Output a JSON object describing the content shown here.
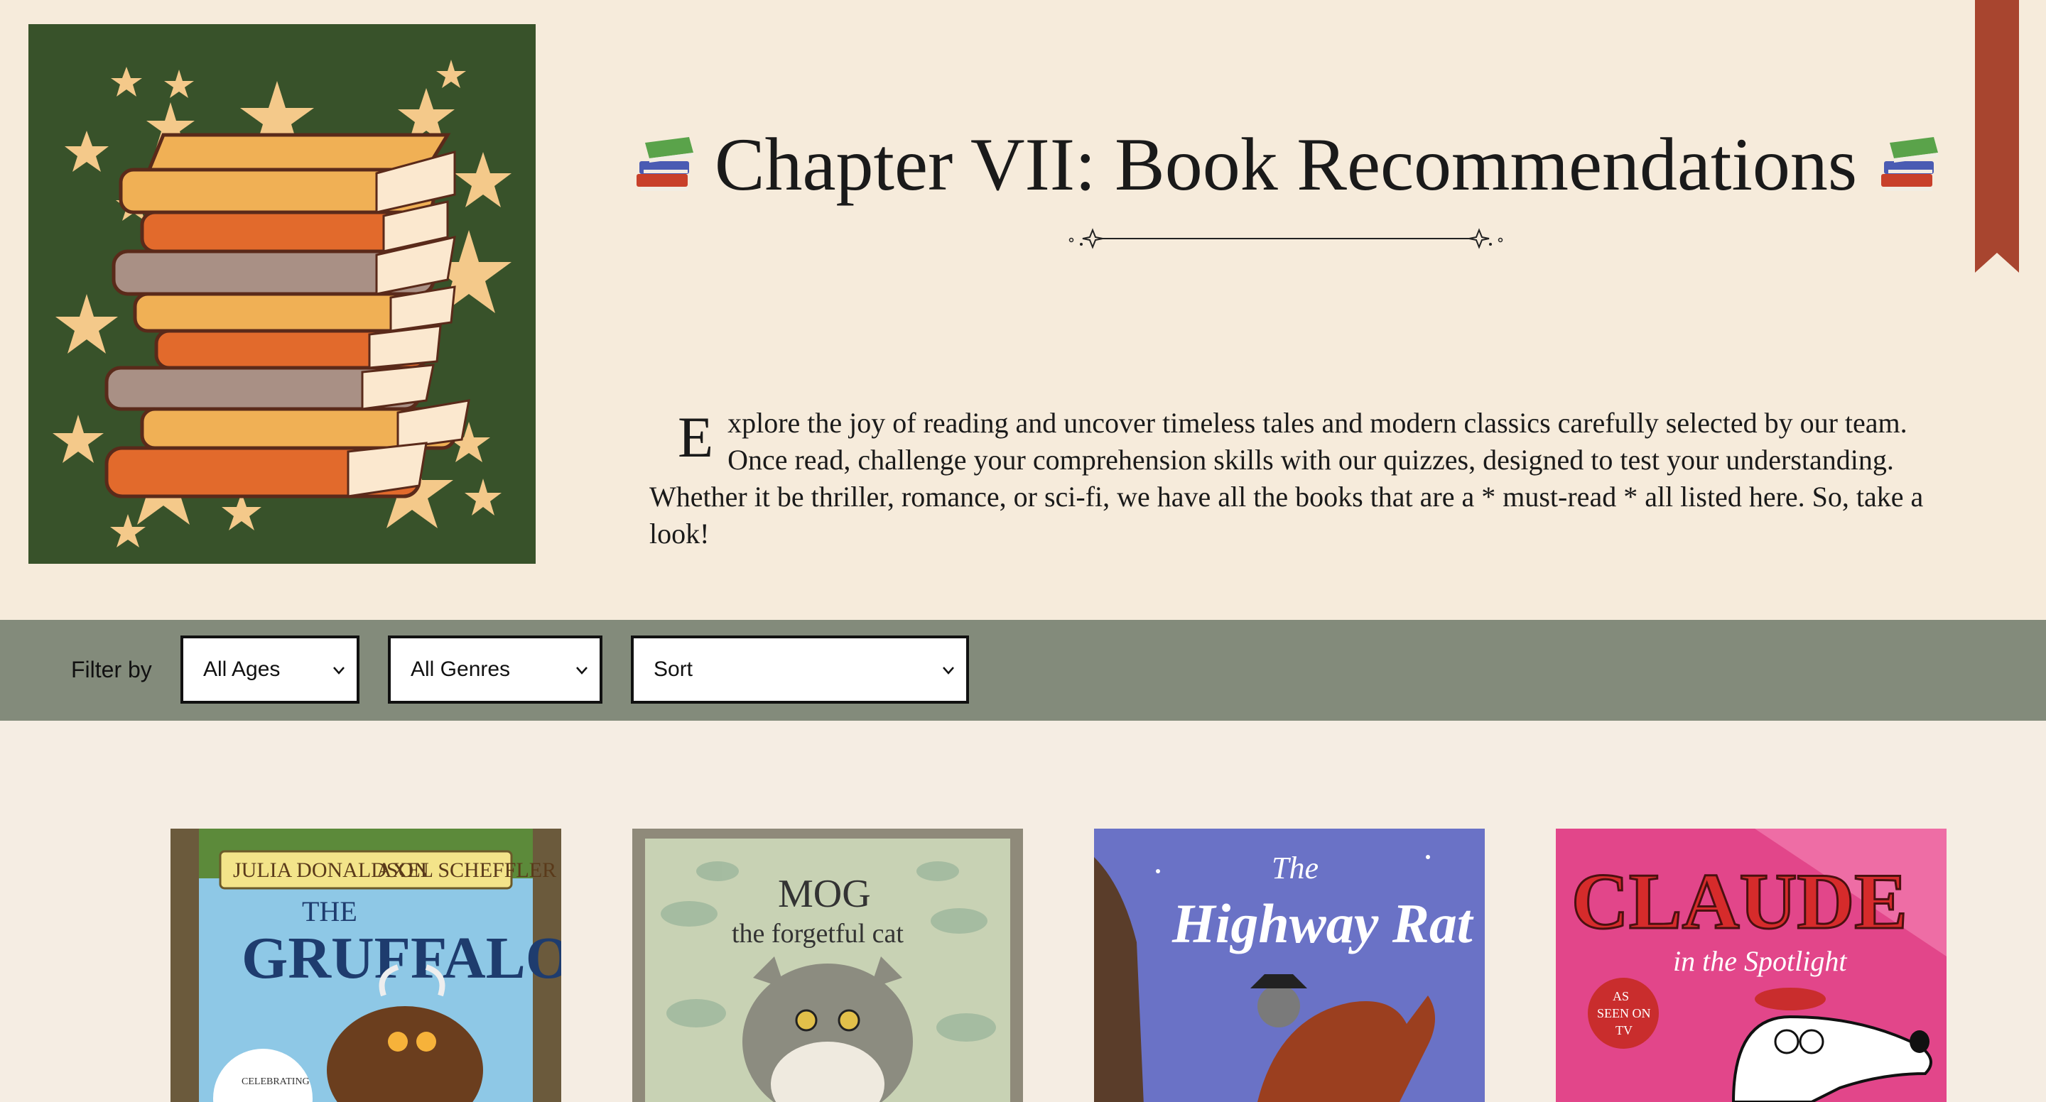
{
  "header": {
    "title": "Chapter VII: Book Recommendations",
    "intro_dropcap": "E",
    "intro_text": "xplore the joy of reading and uncover timeless tales and modern classics carefully selected by our team. Once read, challenge your comprehension skills with our quizzes, designed to test your understanding. Whether it be thriller, romance, or sci-fi, we have all the books that are a * must-read * all listed here. So, take a look!"
  },
  "icons": {
    "title_left": "books-icon",
    "title_right": "books-icon",
    "divider": "sparkle-divider",
    "bookmark": "bookmark-ribbon"
  },
  "colors": {
    "page_background": "#f6ebdb",
    "filter_bar": "#838b7b",
    "bookmark": "#a8452f",
    "hero_background": "#38522a"
  },
  "filters": {
    "label": "Filter by",
    "ages": {
      "selected": "All Ages"
    },
    "genres": {
      "selected": "All Genres"
    },
    "sort": {
      "selected": "Sort"
    }
  },
  "books": [
    {
      "cover_lines": [
        "JULIA DONALDSON",
        "AXEL SCHEFFLER",
        "THE",
        "GRUFFALO",
        "CELEBRATING"
      ]
    },
    {
      "cover_lines": [
        "MOG",
        "the forgetful cat"
      ]
    },
    {
      "cover_lines": [
        "The",
        "Highway Rat"
      ]
    },
    {
      "cover_lines": [
        "CLAUDE",
        "in the Spotlight",
        "AS",
        "SEEN ON",
        "TV"
      ]
    }
  ]
}
